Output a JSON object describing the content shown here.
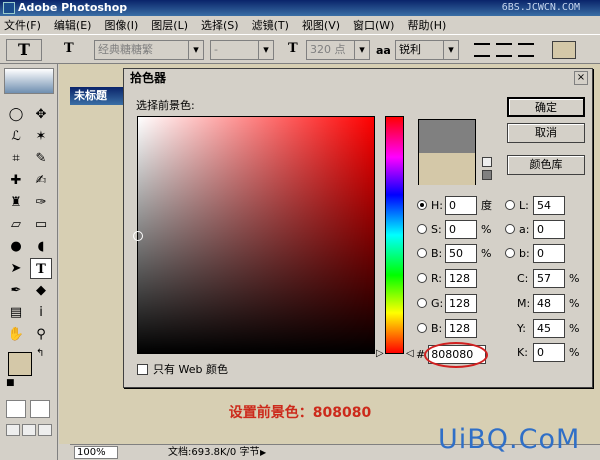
{
  "app": {
    "title": "Adobe Photoshop",
    "watermark": "6BS.JCWCN.COM"
  },
  "menu": [
    "文件(F)",
    "编辑(E)",
    "图像(I)",
    "图层(L)",
    "选择(S)",
    "滤镜(T)",
    "视图(V)",
    "窗口(W)",
    "帮助(H)"
  ],
  "options": {
    "font_family": "经典糖糖繁",
    "font_style": "-",
    "font_size": "320 点",
    "aa_label": "aa",
    "antialias": "锐利"
  },
  "document": {
    "title": "未标题",
    "zoom": "100%",
    "info": "文档:693.8K/0 字节"
  },
  "dialog": {
    "title": "拾色器",
    "subtitle": "选择前景色:",
    "close": "×",
    "buttons": {
      "ok": "确定",
      "cancel": "取消",
      "library": "颜色库"
    },
    "web_only": "只有 Web 颜色",
    "fields": {
      "H": {
        "label": "H:",
        "value": "0",
        "unit": "度"
      },
      "S": {
        "label": "S:",
        "value": "0",
        "unit": "%"
      },
      "B": {
        "label": "B:",
        "value": "50",
        "unit": "%"
      },
      "R": {
        "label": "R:",
        "value": "128"
      },
      "G": {
        "label": "G:",
        "value": "128"
      },
      "Bl": {
        "label": "B:",
        "value": "128"
      },
      "L": {
        "label": "L:",
        "value": "54"
      },
      "a": {
        "label": "a:",
        "value": "0"
      },
      "b": {
        "label": "b:",
        "value": "0"
      },
      "C": {
        "label": "C:",
        "value": "57",
        "unit": "%"
      },
      "M": {
        "label": "M:",
        "value": "48",
        "unit": "%"
      },
      "Y": {
        "label": "Y:",
        "value": "45",
        "unit": "%"
      },
      "K": {
        "label": "K:",
        "value": "0",
        "unit": "%"
      }
    },
    "hex_hash": "#",
    "hex": "808080",
    "new_color": "#808080",
    "current_color": "#d4c8a8"
  },
  "caption": "设置前景色：808080",
  "logo": "UiBQ.CoM",
  "colors": {
    "accent_red": "#cc2a1b",
    "logo_blue": "#2f6fc7"
  }
}
